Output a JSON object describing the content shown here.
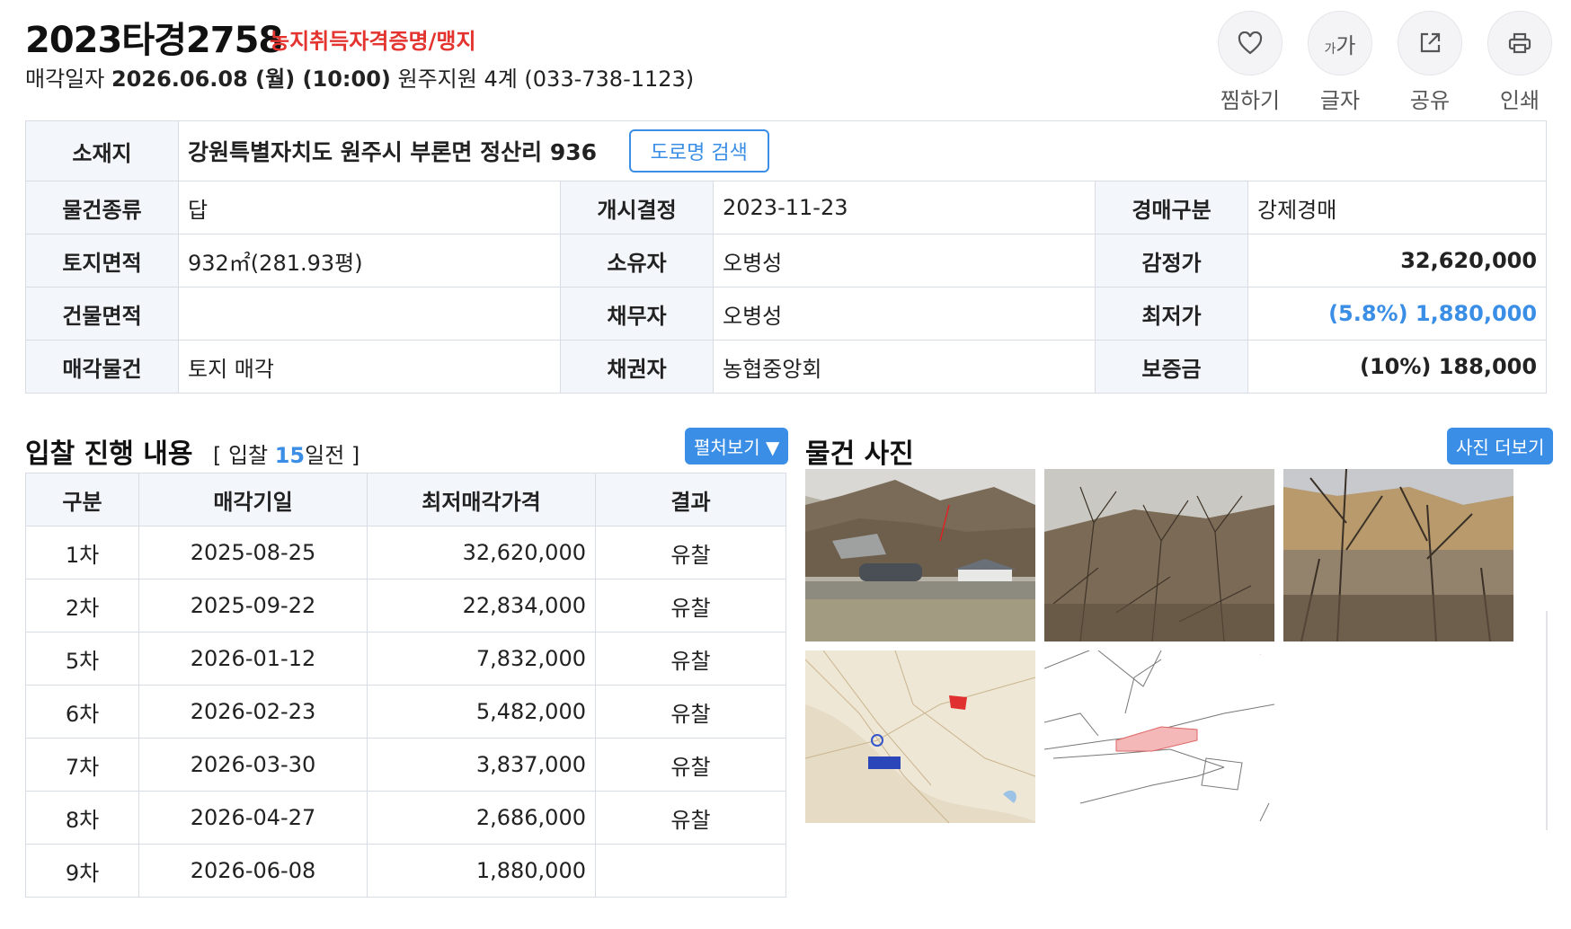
{
  "header": {
    "case_number": "2023타경2758",
    "case_tag": "농지취득자격증명/맹지",
    "sale_label": "매각일자",
    "sale_datetime": "2026.06.08 (월) (10:00)",
    "court_info": "원주지원 4계 (033-738-1123)"
  },
  "actions": [
    {
      "label": "찜하기",
      "icon": "heart-icon"
    },
    {
      "label": "글자",
      "icon": "font-size-icon",
      "glyph_small": "가",
      "glyph_large": "가"
    },
    {
      "label": "공유",
      "icon": "share-icon"
    },
    {
      "label": "인쇄",
      "icon": "print-icon"
    }
  ],
  "info": {
    "address_label": "소재지",
    "address": "강원특별자치도 원주시 부론면 정산리 936",
    "road_search": "도로명 검색",
    "rows": [
      {
        "l1": "물건종류",
        "v1": "답",
        "l2": "개시결정",
        "v2": "2023-11-23",
        "l3": "경매구분",
        "v3": "강제경매"
      },
      {
        "l1": "토지면적",
        "v1": "932㎡(281.93평)",
        "l2": "소유자",
        "v2": "오병성",
        "l3": "감정가",
        "v3": "32,620,000"
      },
      {
        "l1": "건물면적",
        "v1": "",
        "l2": "채무자",
        "v2": "오병성",
        "l3": "최저가",
        "v3": "(5.8%) 1,880,000"
      },
      {
        "l1": "매각물건",
        "v1": "토지 매각",
        "l2": "채권자",
        "v2": "농협중앙회",
        "l3": "보증금",
        "v3": "(10%) 188,000"
      }
    ]
  },
  "bidding": {
    "title": "입찰 진행 내용",
    "sub_prefix": "[ 입찰 ",
    "sub_days": "15",
    "sub_suffix": "일전 ]",
    "expand_label": "펼처보기 ▼",
    "columns": [
      "구분",
      "매각기일",
      "최저매각가격",
      "결과"
    ],
    "rows": [
      {
        "round": "1차",
        "date": "2025-08-25",
        "price": "32,620,000",
        "result": "유찰"
      },
      {
        "round": "2차",
        "date": "2025-09-22",
        "price": "22,834,000",
        "result": "유찰"
      },
      {
        "round": "5차",
        "date": "2026-01-12",
        "price": "7,832,000",
        "result": "유찰"
      },
      {
        "round": "6차",
        "date": "2026-02-23",
        "price": "5,482,000",
        "result": "유찰"
      },
      {
        "round": "7차",
        "date": "2026-03-30",
        "price": "3,837,000",
        "result": "유찰"
      },
      {
        "round": "8차",
        "date": "2026-04-27",
        "price": "2,686,000",
        "result": "유찰"
      },
      {
        "round": "9차",
        "date": "2026-06-08",
        "price": "1,880,000",
        "result": ""
      }
    ]
  },
  "photos": {
    "title": "물건 사진",
    "more_label": "사진 더보기",
    "items": [
      {
        "name": "photo-landscape-house"
      },
      {
        "name": "photo-brush-hillside"
      },
      {
        "name": "photo-bare-trees"
      },
      {
        "name": "photo-location-map"
      },
      {
        "name": "photo-cadastral-map"
      }
    ]
  },
  "colors": {
    "accent": "#3a8ee6",
    "tag_red": "#e3342f",
    "label_bg": "#f3f6fa",
    "border": "#d8dde5"
  }
}
